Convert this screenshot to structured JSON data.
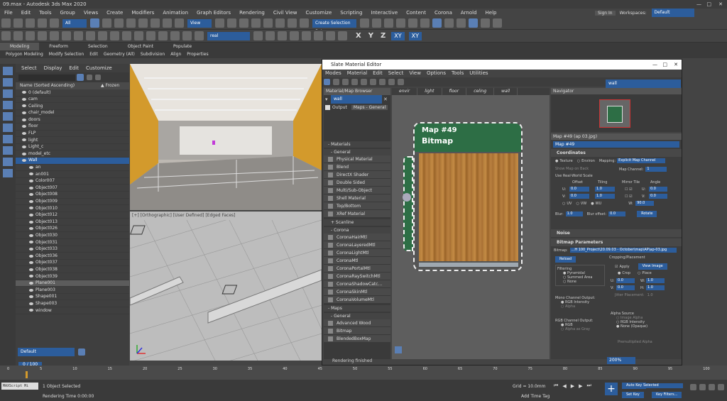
{
  "app": {
    "title": "09.max - Autodesk 3ds Max 2020"
  },
  "menu": [
    "File",
    "Edit",
    "Tools",
    "Group",
    "Views",
    "Create",
    "Modifiers",
    "Animation",
    "Graph Editors",
    "Rendering",
    "Civil View",
    "Customize",
    "Scripting",
    "Interactive",
    "Content",
    "Corona",
    "Arnold",
    "Help"
  ],
  "account": {
    "sign_in": "Sign In",
    "workspaces_label": "Workspaces:",
    "workspace": "Default"
  },
  "toolbar": {
    "filter": "All",
    "view": "View",
    "selection_set": "Create Selection Set",
    "named_set": "real",
    "axes": [
      "X",
      "Y",
      "Z",
      "XY",
      "XY"
    ]
  },
  "ribbon": {
    "tabs": [
      "Modeling",
      "Freeform",
      "Selection",
      "Object Paint",
      "Populate"
    ],
    "subtabs": [
      "Polygon Modeling",
      "Modify Selection",
      "Edit",
      "Geometry (All)",
      "Subdivision",
      "Align",
      "Properties"
    ]
  },
  "scene_explorer": {
    "menu": [
      "Select",
      "Display",
      "Edit",
      "Customize"
    ],
    "header": "Name (Sorted Ascending)",
    "frozen": "▲ Frozen",
    "items": [
      {
        "name": "0 (default)",
        "level": 0,
        "state": ""
      },
      {
        "name": "cam",
        "level": 0,
        "state": ""
      },
      {
        "name": "Ceiling",
        "level": 0,
        "state": ""
      },
      {
        "name": "chair_model",
        "level": 0,
        "state": ""
      },
      {
        "name": "doors",
        "level": 0,
        "state": ""
      },
      {
        "name": "floor",
        "level": 0,
        "state": ""
      },
      {
        "name": "FLP",
        "level": 0,
        "state": ""
      },
      {
        "name": "light",
        "level": 0,
        "state": ""
      },
      {
        "name": "Light_c",
        "level": 0,
        "state": ""
      },
      {
        "name": "model_etc",
        "level": 0,
        "state": ""
      },
      {
        "name": "Wall",
        "level": 0,
        "state": "hl"
      },
      {
        "name": "an",
        "level": 1,
        "state": ""
      },
      {
        "name": "an001",
        "level": 1,
        "state": ""
      },
      {
        "name": "Color007",
        "level": 1,
        "state": ""
      },
      {
        "name": "Object007",
        "level": 1,
        "state": ""
      },
      {
        "name": "Object008",
        "level": 1,
        "state": ""
      },
      {
        "name": "Object009",
        "level": 1,
        "state": ""
      },
      {
        "name": "Object010",
        "level": 1,
        "state": ""
      },
      {
        "name": "Object012",
        "level": 1,
        "state": ""
      },
      {
        "name": "Object013",
        "level": 1,
        "state": ""
      },
      {
        "name": "Object026",
        "level": 1,
        "state": ""
      },
      {
        "name": "Object030",
        "level": 1,
        "state": ""
      },
      {
        "name": "Object031",
        "level": 1,
        "state": ""
      },
      {
        "name": "Object033",
        "level": 1,
        "state": ""
      },
      {
        "name": "Object036",
        "level": 1,
        "state": ""
      },
      {
        "name": "Object037",
        "level": 1,
        "state": ""
      },
      {
        "name": "Object038",
        "level": 1,
        "state": ""
      },
      {
        "name": "Object039",
        "level": 1,
        "state": ""
      },
      {
        "name": "Plane001",
        "level": 1,
        "state": "sel"
      },
      {
        "name": "Plane003",
        "level": 1,
        "state": ""
      },
      {
        "name": "Shape001",
        "level": 1,
        "state": ""
      },
      {
        "name": "Shape003",
        "level": 1,
        "state": ""
      },
      {
        "name": "window",
        "level": 1,
        "state": ""
      }
    ],
    "layer": "Default"
  },
  "viewport2": {
    "label": "[+] [Orthographic] [User Defined] [Edged Faces]"
  },
  "slate": {
    "title": "Slate Material Editor",
    "menu": [
      "Modes",
      "Material",
      "Edit",
      "Select",
      "View",
      "Options",
      "Tools",
      "Utilities"
    ],
    "browser_title": "Material/Map Browser",
    "search": "wall",
    "output_label": "Output",
    "output_value": "Maps - General",
    "materials_header": "- Materials",
    "general_header": "- General",
    "general_items": [
      "Physical Material",
      "Blend",
      "DirectX Shader",
      "Double Sided",
      "Multi/Sub-Object",
      "Shell Material",
      "Top/Bottom",
      "XRef Material"
    ],
    "scanline_header": "+ Scanline",
    "corona_header": "- Corona",
    "corona_items": [
      "CoronaHairMtl",
      "CoronaLayeredMtl",
      "CoronaLightMtl",
      "CoronaMtl",
      "CoronaPortalMtl",
      "CoronaRaySwitchMtl",
      "CoronaShadowCatc...",
      "CoronaSkinMtl",
      "CoronaVolumeMtl"
    ],
    "maps_header": "- Maps",
    "maps_general_header": "- General",
    "maps_items": [
      "Advanced Wood",
      "Bitmap",
      "BlendedBoxMap"
    ],
    "view_tabs": [
      "envir",
      "light",
      "floor",
      "celing",
      "wall"
    ],
    "view_dropdown": "wall",
    "node_title": "Map #49",
    "node_type": "Bitmap",
    "navigator_title": "Navigator",
    "props_title": "Map #49 (ap 03.jpg)",
    "props_name": "Map #49",
    "coordinates": "Coordinates",
    "texture": "Texture",
    "environ": "Environ",
    "mapping_label": "Mapping:",
    "mapping_value": "Explicit Map Channel",
    "show_map": "Show Map on Back",
    "map_channel": "Map Channel:",
    "map_channel_value": "1",
    "real_world": "Use Real-World Scale",
    "col_offset": "Offset",
    "col_tiling": "Tiling",
    "col_mirror": "Mirror Tile",
    "col_angle": "Angle",
    "u_label": "U:",
    "v_label": "V:",
    "w_label": "W:",
    "offset_u": "0.0",
    "offset_v": "0.0",
    "tiling_u": "1.0",
    "tiling_v": "1.0",
    "angle_u": "0.0",
    "angle_v": "0.0",
    "angle_w": "90.0",
    "uv": "UV",
    "vw": "VW",
    "wu": "WU",
    "blur_label": "Blur:",
    "blur_value": "1.0",
    "blur_offset_label": "Blur offset:",
    "blur_offset_value": "0.0",
    "rotate": "Rotate",
    "noise": "Noise",
    "bitmap_params": "Bitmap Parameters",
    "bitmap_label": "Bitmap:",
    "bitmap_path": "...H 100_Project\\20.09.03 - October\\map\\AP\\ap-03.jpg",
    "reload": "Reload",
    "cropping": "Cropping/Placement",
    "apply": "Apply",
    "view_image": "View Image",
    "crop": "Crop",
    "place": "Place",
    "filtering": "Filtering",
    "pyramidal": "Pyramidal",
    "summed_area": "Summed Area",
    "none": "None",
    "mono_output": "Mono Channel Output:",
    "rgb_intensity": "RGB Intensity",
    "alpha": "Alpha",
    "rgb_output": "RGB Channel Output:",
    "rgb": "RGB",
    "alpha_as_gray": "Alpha as Gray",
    "alpha_source": "Alpha Source",
    "image_alpha": "Image Alpha",
    "none_opaque": "None (Opaque)",
    "premultiplied": "Premultiplied Alpha",
    "jitter": "Jitter Placement:",
    "crop_u": "0.0",
    "crop_v": "0.0",
    "crop_w": "1.0",
    "crop_h": "1.0",
    "jitter_value": "1.0",
    "rendering_status": "Rendering finished",
    "zoom": "200%"
  },
  "status": {
    "selected": "1 Object Selected",
    "render_time": "Rendering Time 0:00:00",
    "maxscript": "MAXScript Mi",
    "frame": "0 / 100",
    "grid": "Grid = 10.0mm",
    "add_time_tag": "Add Time Tag",
    "autokey": "Auto Key",
    "setkey": "Set Key",
    "selected_dd": "Selected",
    "key_filters": "Key Filters...",
    "ticks": [
      "0",
      "5",
      "10",
      "15",
      "20",
      "25",
      "30",
      "35",
      "40",
      "45",
      "50",
      "55",
      "60",
      "65",
      "70",
      "75",
      "80",
      "85",
      "90",
      "95",
      "100"
    ]
  },
  "colors": {
    "accent": "#2c5d9c",
    "node_header": "#2d6e45",
    "wall_orange": "#d39a2c"
  }
}
